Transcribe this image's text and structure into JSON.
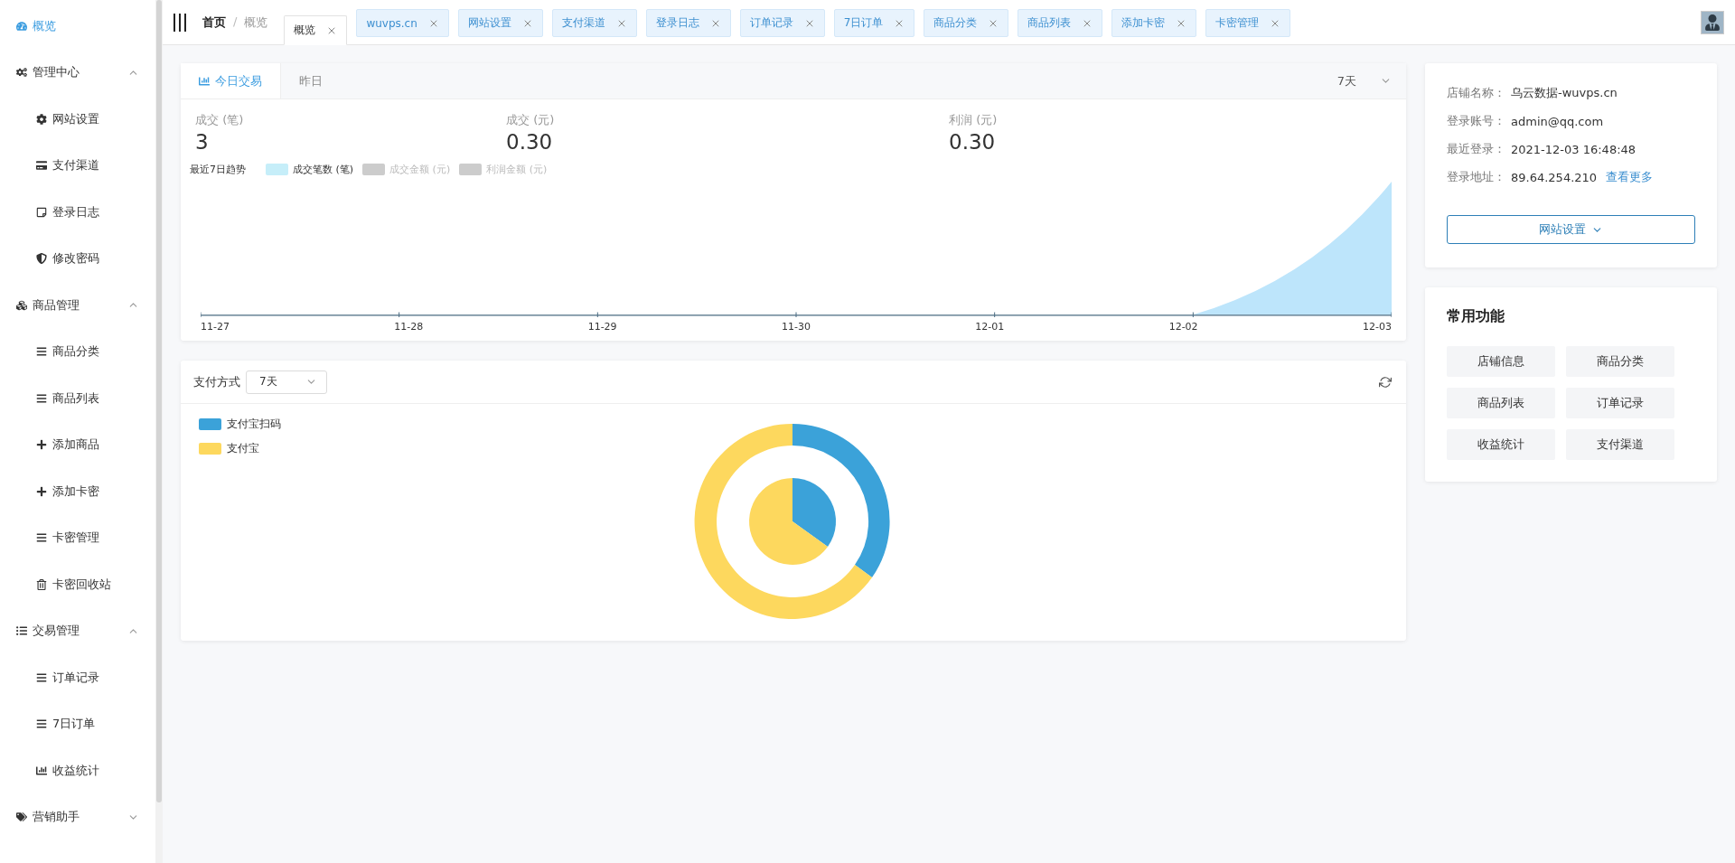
{
  "sidebar": {
    "items": [
      {
        "label": "概览",
        "selected": true
      },
      {
        "label": "管理中心",
        "expanded": true,
        "children": [
          {
            "label": "网站设置",
            "selected": false
          },
          {
            "label": "支付渠道",
            "selected": false
          },
          {
            "label": "登录日志",
            "selected": false
          },
          {
            "label": "修改密码",
            "selected": false
          }
        ]
      },
      {
        "label": "商品管理",
        "expanded": true,
        "children": [
          {
            "label": "商品分类",
            "selected": false
          },
          {
            "label": "商品列表",
            "selected": false
          },
          {
            "label": "添加商品",
            "selected": false
          },
          {
            "label": "添加卡密",
            "selected": false
          },
          {
            "label": "卡密管理",
            "selected": false
          },
          {
            "label": "卡密回收站",
            "selected": false
          }
        ]
      },
      {
        "label": "交易管理",
        "expanded": true,
        "children": [
          {
            "label": "订单记录",
            "selected": false
          },
          {
            "label": "7日订单",
            "selected": false
          },
          {
            "label": "收益统计",
            "selected": false
          }
        ]
      },
      {
        "label": "营销助手",
        "expanded": false
      }
    ]
  },
  "breadcrumb": [
    "首页",
    "概览"
  ],
  "breadcrumb_separator": "/",
  "page_tabs": [
    {
      "label": "概览",
      "selected": true
    },
    {
      "label": "wuvps.cn",
      "selected": false
    },
    {
      "label": "网站设置",
      "selected": false
    },
    {
      "label": "支付渠道",
      "selected": false
    },
    {
      "label": "登录日志",
      "selected": false
    },
    {
      "label": "订单记录",
      "selected": false
    },
    {
      "label": "7日订单",
      "selected": false
    },
    {
      "label": "商品分类",
      "selected": false
    },
    {
      "label": "商品列表",
      "selected": false
    },
    {
      "label": "添加卡密",
      "selected": false
    },
    {
      "label": "卡密管理",
      "selected": false
    }
  ],
  "trade_card": {
    "tabs": [
      {
        "label": "今日交易",
        "selected": true
      },
      {
        "label": "昨日",
        "selected": false
      }
    ],
    "range": "7天",
    "stats": [
      {
        "label": "成交 (笔)",
        "value": "3"
      },
      {
        "label": "成交 (元)",
        "value": "0.30"
      },
      {
        "label": "利润 (元)",
        "value": "0.30"
      }
    ],
    "trend": {
      "title": "最近7日趋势",
      "legend": [
        {
          "label": "成交笔数 (笔)",
          "on": true,
          "color": "#c6eef9"
        },
        {
          "label": "成交金额 (元)",
          "on": false,
          "color": "#cccccc"
        },
        {
          "label": "利润金额 (元)",
          "on": false,
          "color": "#cccccc"
        }
      ],
      "dates": [
        "11-27",
        "11-28",
        "11-29",
        "11-30",
        "12-01",
        "12-02",
        "12-03"
      ]
    }
  },
  "payment_card": {
    "title": "支付方式",
    "range": "7天",
    "legend": [
      {
        "label": "支付宝扫码",
        "color": "#3ba2d9"
      },
      {
        "label": "支付宝",
        "color": "#fdd85e"
      }
    ]
  },
  "shop_info": {
    "rows": [
      {
        "label": "店铺名称：",
        "value": "乌云数据-wuvps.cn"
      },
      {
        "label": "登录账号：",
        "value": "admin@qq.com"
      },
      {
        "label": "最近登录：",
        "value": "2021-12-03 16:48:48"
      },
      {
        "label": "登录地址：",
        "value": "89.64.254.210",
        "link": "查看更多"
      }
    ],
    "button": "网站设置"
  },
  "shortcuts": {
    "title": "常用功能",
    "items": [
      "店铺信息",
      "商品分类",
      "商品列表",
      "订单记录",
      "收益统计",
      "支付渠道"
    ]
  }
}
